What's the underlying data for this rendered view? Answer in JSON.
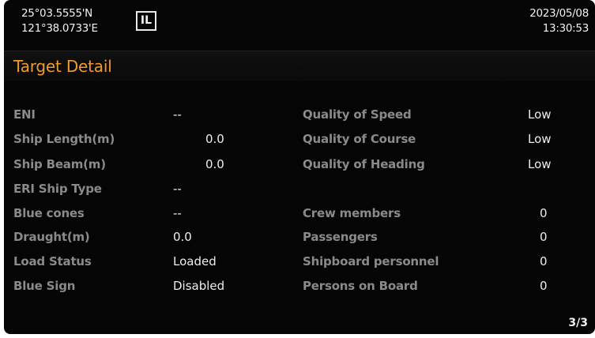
{
  "header": {
    "lat": "25°03.5555'N",
    "lon": "121°38.0733'E",
    "mode_badge": "IL",
    "date": "2023/05/08",
    "time": "13:30:53"
  },
  "title": "Target Detail",
  "left_fields": [
    {
      "label": "ENI",
      "value": "--"
    },
    {
      "label": "Ship Length(m)",
      "value": "0.0"
    },
    {
      "label": "Ship Beam(m)",
      "value": "0.0"
    },
    {
      "label": "ERI Ship Type",
      "value": "--"
    },
    {
      "label": "Blue cones",
      "value": "--"
    },
    {
      "label": "Draught(m)",
      "value": "0.0"
    },
    {
      "label": "Load Status",
      "value": "Loaded"
    },
    {
      "label": "Blue Sign",
      "value": "Disabled"
    }
  ],
  "right_fields": [
    {
      "label": "Quality of Speed",
      "value": "Low"
    },
    {
      "label": "Quality of Course",
      "value": "Low"
    },
    {
      "label": "Quality of Heading",
      "value": "Low"
    },
    {
      "label": "Crew members",
      "value": "0"
    },
    {
      "label": "Passengers",
      "value": "0"
    },
    {
      "label": "Shipboard personnel",
      "value": "0"
    },
    {
      "label": "Persons on Board",
      "value": "0"
    }
  ],
  "page_indicator": "3/3",
  "colors": {
    "title": "#f09a2e",
    "label": "#8a8a8a",
    "value": "#eeeeee",
    "background": "#050505"
  }
}
